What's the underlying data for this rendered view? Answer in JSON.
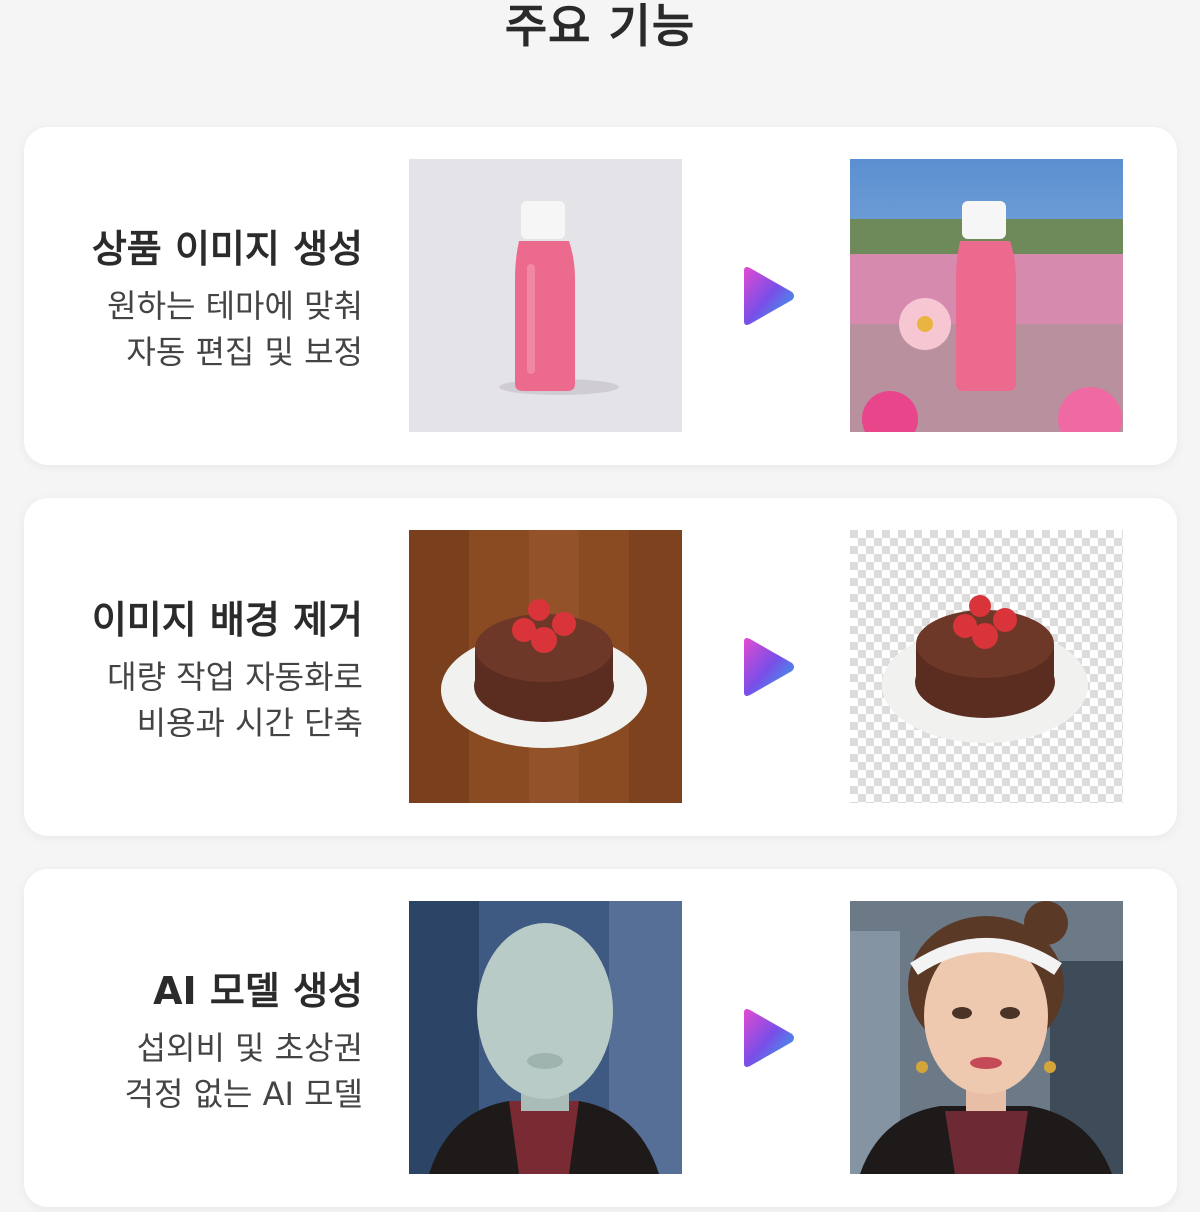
{
  "header": {
    "title": "주요 기능"
  },
  "features": [
    {
      "title": "상품 이미지 생성",
      "desc_line1": "원하는 테마에 맞춰",
      "desc_line2": "자동 편집 및 보정"
    },
    {
      "title": "이미지 배경 제거",
      "desc_line1": "대량 작업 자동화로",
      "desc_line2": "비용과 시간 단축"
    },
    {
      "title": "AI 모델 생성",
      "desc_line1": "섭외비 및 초상권",
      "desc_line2": "걱정 없는 AI 모델"
    }
  ],
  "colors": {
    "background": "#f5f5f5",
    "card": "#ffffff",
    "arrow_gradient": [
      "#e24bd0",
      "#7a4ee8",
      "#2bb0e8"
    ]
  },
  "icons": {
    "arrow": "play-arrow-icon"
  }
}
